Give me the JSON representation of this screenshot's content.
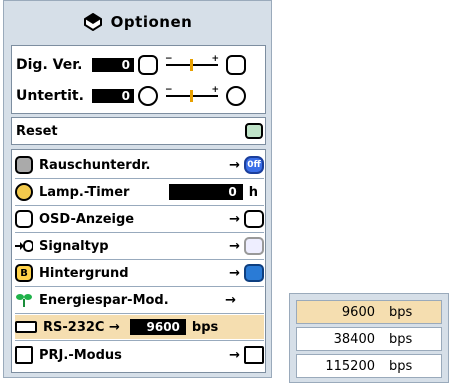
{
  "menu": {
    "title": "Optionen",
    "adjust": [
      {
        "label": "Dig. Ver.",
        "value": "0",
        "minus": "−",
        "plus": "+"
      },
      {
        "label": "Untertit.",
        "value": "0",
        "minus": "−",
        "plus": "+"
      }
    ],
    "reset_label": "Reset",
    "items": [
      {
        "label": "Rauschunterdr.",
        "arrow": "→",
        "end": "0ff"
      },
      {
        "label": "Lamp.-Timer",
        "value": "0",
        "unit": "h"
      },
      {
        "label": "OSD-Anzeige",
        "arrow": "→"
      },
      {
        "label": "Signaltyp",
        "arrow": "→"
      },
      {
        "label": "Hintergrund",
        "arrow": "→"
      },
      {
        "label": "Energiespar-Mod.",
        "arrow": "→"
      },
      {
        "label": "RS-232C",
        "arrow": "→",
        "value": "9600",
        "unit": "bps"
      },
      {
        "label": "PRJ.-Modus",
        "arrow": "→"
      }
    ]
  },
  "baud_list": [
    {
      "value": "9600",
      "unit": "bps",
      "selected": true
    },
    {
      "value": "38400",
      "unit": "bps"
    },
    {
      "value": "115200",
      "unit": "bps"
    }
  ],
  "colors": {
    "menu_bg": "#d6dfe8",
    "selected": "#f5deb0",
    "panel_border": "#7d8ea0"
  }
}
